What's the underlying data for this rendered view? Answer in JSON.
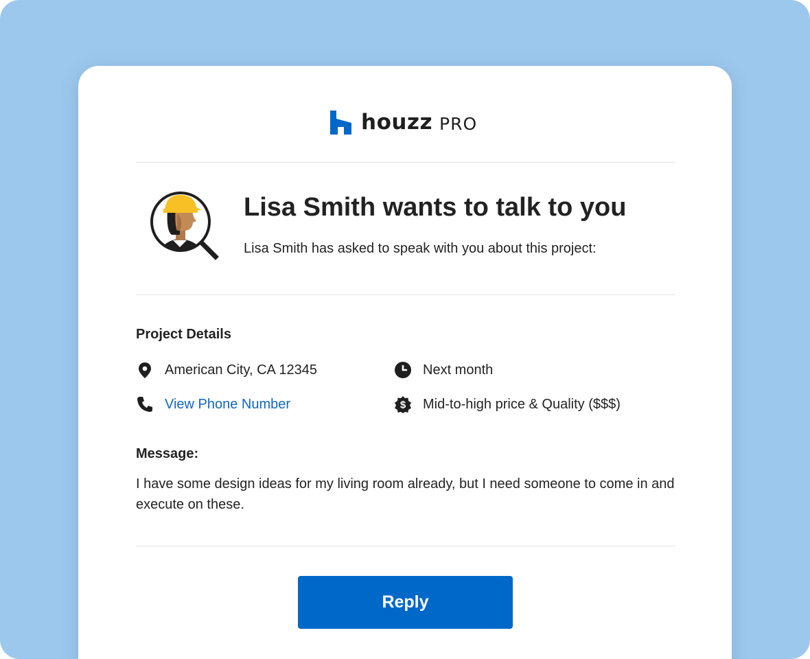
{
  "brand": {
    "name": "houzz",
    "suffix": "PRO",
    "color": "#0068c9",
    "icon": "houzz-logo-icon"
  },
  "lead": {
    "headline": "Lisa Smith wants to talk to you",
    "subline": "Lisa Smith has asked to speak with you about this project:",
    "avatar_icon": "contractor-search-icon"
  },
  "project": {
    "section_title": "Project Details",
    "details": [
      {
        "icon": "location-pin-icon",
        "text": "American City, CA 12345"
      },
      {
        "icon": "clock-icon",
        "text": "Next month"
      },
      {
        "icon": "phone-icon",
        "text": "View Phone Number",
        "link": true
      },
      {
        "icon": "dollar-badge-icon",
        "text": "Mid-to-high price & Quality ($$$)"
      }
    ]
  },
  "message": {
    "title": "Message:",
    "body": "I have some design ideas for my living room already, but I need someone to come in and execute on these."
  },
  "actions": {
    "reply_label": "Reply"
  },
  "colors": {
    "background": "#9dc8ed",
    "card": "#ffffff",
    "link": "#0d67c5",
    "button": "#0068c9",
    "hard_hat": "#f7c125"
  }
}
